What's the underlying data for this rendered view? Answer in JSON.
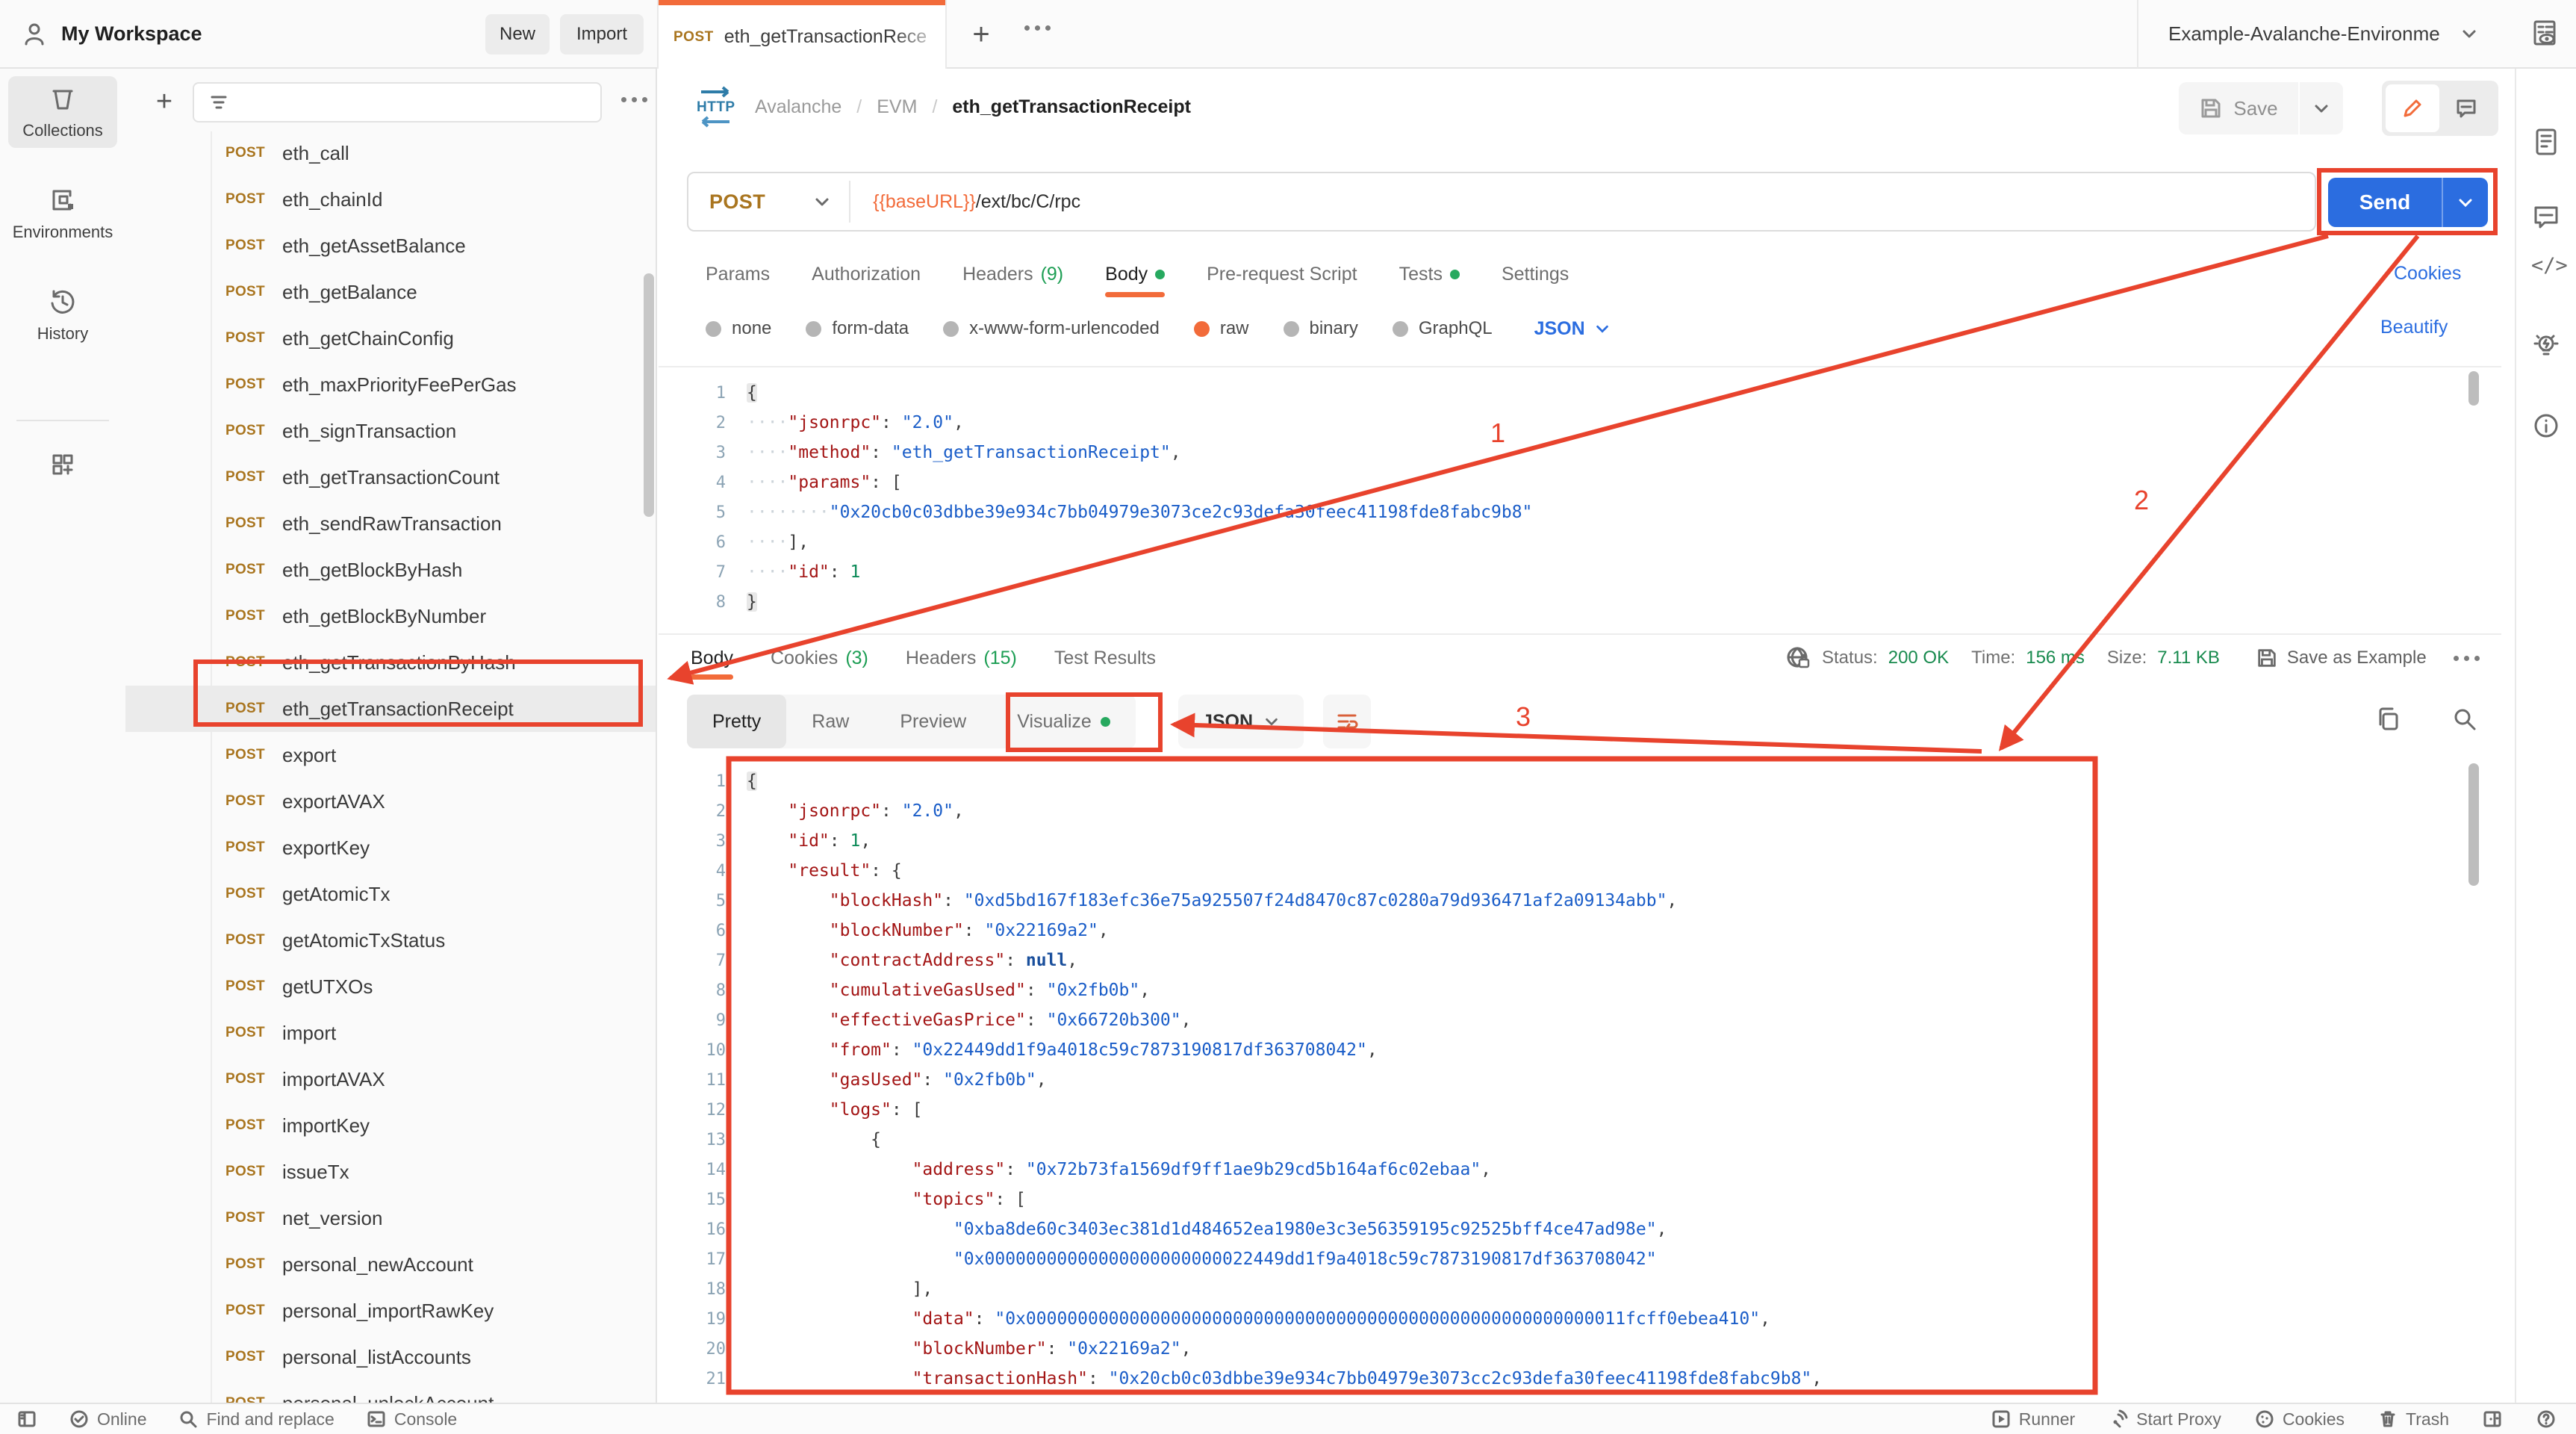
{
  "header": {
    "workspace": "My Workspace",
    "new_button": "New",
    "import_button": "Import",
    "environment": "Example-Avalanche-Environme",
    "tab": {
      "method": "POST",
      "title": "eth_getTransactionRece"
    }
  },
  "left_rail": {
    "items": [
      {
        "label": "Collections",
        "active": true
      },
      {
        "label": "Environments",
        "active": false
      },
      {
        "label": "History",
        "active": false
      }
    ]
  },
  "collection": {
    "selected_index": 12,
    "requests": [
      {
        "method": "POST",
        "name": "eth_call"
      },
      {
        "method": "POST",
        "name": "eth_chainId"
      },
      {
        "method": "POST",
        "name": "eth_getAssetBalance"
      },
      {
        "method": "POST",
        "name": "eth_getBalance"
      },
      {
        "method": "POST",
        "name": "eth_getChainConfig"
      },
      {
        "method": "POST",
        "name": "eth_maxPriorityFeePerGas"
      },
      {
        "method": "POST",
        "name": "eth_signTransaction"
      },
      {
        "method": "POST",
        "name": "eth_getTransactionCount"
      },
      {
        "method": "POST",
        "name": "eth_sendRawTransaction"
      },
      {
        "method": "POST",
        "name": "eth_getBlockByHash"
      },
      {
        "method": "POST",
        "name": "eth_getBlockByNumber"
      },
      {
        "method": "POST",
        "name": "eth_getTransactionByHash"
      },
      {
        "method": "POST",
        "name": "eth_getTransactionReceipt"
      },
      {
        "method": "POST",
        "name": "export"
      },
      {
        "method": "POST",
        "name": "exportAVAX"
      },
      {
        "method": "POST",
        "name": "exportKey"
      },
      {
        "method": "POST",
        "name": "getAtomicTx"
      },
      {
        "method": "POST",
        "name": "getAtomicTxStatus"
      },
      {
        "method": "POST",
        "name": "getUTXOs"
      },
      {
        "method": "POST",
        "name": "import"
      },
      {
        "method": "POST",
        "name": "importAVAX"
      },
      {
        "method": "POST",
        "name": "importKey"
      },
      {
        "method": "POST",
        "name": "issueTx"
      },
      {
        "method": "POST",
        "name": "net_version"
      },
      {
        "method": "POST",
        "name": "personal_newAccount"
      },
      {
        "method": "POST",
        "name": "personal_importRawKey"
      },
      {
        "method": "POST",
        "name": "personal_listAccounts"
      },
      {
        "method": "POST",
        "name": "personal_unlockAccount"
      }
    ]
  },
  "request": {
    "breadcrumb": [
      "Avalanche",
      "EVM"
    ],
    "title": "eth_getTransactionReceipt",
    "save": "Save",
    "method": "POST",
    "url_var": "{{baseURL}}",
    "url_path": "/ext/bc/C/rpc",
    "send": "Send",
    "cookies_link": "Cookies",
    "beautify_link": "Beautify",
    "language": "JSON",
    "tabs": [
      {
        "label": "Params"
      },
      {
        "label": "Authorization"
      },
      {
        "label": "Headers",
        "count": "(9)"
      },
      {
        "label": "Body",
        "active": true,
        "dot": true
      },
      {
        "label": "Pre-request Script"
      },
      {
        "label": "Tests",
        "dot": true
      },
      {
        "label": "Settings"
      }
    ],
    "body_types": [
      {
        "label": "none"
      },
      {
        "label": "form-data"
      },
      {
        "label": "x-www-form-urlencoded"
      },
      {
        "label": "raw",
        "selected": true
      },
      {
        "label": "binary"
      },
      {
        "label": "GraphQL"
      }
    ],
    "code": [
      [
        [
          "ph",
          "{"
        ]
      ],
      [
        [
          "ws",
          "····"
        ],
        [
          "k",
          "\"jsonrpc\""
        ],
        [
          "p",
          ": "
        ],
        [
          "s",
          "\"2.0\""
        ],
        [
          "p",
          ","
        ]
      ],
      [
        [
          "ws",
          "····"
        ],
        [
          "k",
          "\"method\""
        ],
        [
          "p",
          ": "
        ],
        [
          "s",
          "\"eth_getTransactionReceipt\""
        ],
        [
          "p",
          ","
        ]
      ],
      [
        [
          "ws",
          "····"
        ],
        [
          "k",
          "\"params\""
        ],
        [
          "p",
          ": "
        ],
        [
          "p",
          "["
        ]
      ],
      [
        [
          "ws",
          "········"
        ],
        [
          "s",
          "\"0x20cb0c03dbbe39e934c7bb04979e3073ce2c93defa30feec41198fde8fabc9b8\""
        ]
      ],
      [
        [
          "ws",
          "····"
        ],
        [
          "p",
          "],"
        ]
      ],
      [
        [
          "ws",
          "····"
        ],
        [
          "k",
          "\"id\""
        ],
        [
          "p",
          ": "
        ],
        [
          "n",
          "1"
        ]
      ],
      [
        [
          "ph",
          "}"
        ]
      ]
    ]
  },
  "response": {
    "status_label": "Status:",
    "status": "200 OK",
    "time_label": "Time:",
    "time": "156 ms",
    "size_label": "Size:",
    "size": "7.11 KB",
    "save_as_example": "Save as Example",
    "language": "JSON",
    "tabs": [
      {
        "label": "Body",
        "active": true
      },
      {
        "label": "Cookies",
        "count": "(3)"
      },
      {
        "label": "Headers",
        "count": "(15)"
      },
      {
        "label": "Test Results"
      }
    ],
    "view_tabs": [
      {
        "label": "Pretty",
        "active": true
      },
      {
        "label": "Raw"
      },
      {
        "label": "Preview"
      },
      {
        "label": "Visualize",
        "dot": true
      }
    ],
    "code": [
      [
        [
          "ph",
          "{"
        ]
      ],
      [
        [
          "sp",
          "    "
        ],
        [
          "k",
          "\"jsonrpc\""
        ],
        [
          "p",
          ": "
        ],
        [
          "s",
          "\"2.0\""
        ],
        [
          "p",
          ","
        ]
      ],
      [
        [
          "sp",
          "    "
        ],
        [
          "k",
          "\"id\""
        ],
        [
          "p",
          ": "
        ],
        [
          "n",
          "1"
        ],
        [
          "p",
          ","
        ]
      ],
      [
        [
          "sp",
          "    "
        ],
        [
          "k",
          "\"result\""
        ],
        [
          "p",
          ": "
        ],
        [
          "p",
          "{"
        ]
      ],
      [
        [
          "sp",
          "        "
        ],
        [
          "k",
          "\"blockHash\""
        ],
        [
          "p",
          ": "
        ],
        [
          "s",
          "\"0xd5bd167f183efc36e75a925507f24d8470c87c0280a79d936471af2a09134abb\""
        ],
        [
          "p",
          ","
        ]
      ],
      [
        [
          "sp",
          "        "
        ],
        [
          "k",
          "\"blockNumber\""
        ],
        [
          "p",
          ": "
        ],
        [
          "s",
          "\"0x22169a2\""
        ],
        [
          "p",
          ","
        ]
      ],
      [
        [
          "sp",
          "        "
        ],
        [
          "k",
          "\"contractAddress\""
        ],
        [
          "p",
          ": "
        ],
        [
          "kw",
          "null"
        ],
        [
          "p",
          ","
        ]
      ],
      [
        [
          "sp",
          "        "
        ],
        [
          "k",
          "\"cumulativeGasUsed\""
        ],
        [
          "p",
          ": "
        ],
        [
          "s",
          "\"0x2fb0b\""
        ],
        [
          "p",
          ","
        ]
      ],
      [
        [
          "sp",
          "        "
        ],
        [
          "k",
          "\"effectiveGasPrice\""
        ],
        [
          "p",
          ": "
        ],
        [
          "s",
          "\"0x66720b300\""
        ],
        [
          "p",
          ","
        ]
      ],
      [
        [
          "sp",
          "        "
        ],
        [
          "k",
          "\"from\""
        ],
        [
          "p",
          ": "
        ],
        [
          "s",
          "\"0x22449dd1f9a4018c59c7873190817df363708042\""
        ],
        [
          "p",
          ","
        ]
      ],
      [
        [
          "sp",
          "        "
        ],
        [
          "k",
          "\"gasUsed\""
        ],
        [
          "p",
          ": "
        ],
        [
          "s",
          "\"0x2fb0b\""
        ],
        [
          "p",
          ","
        ]
      ],
      [
        [
          "sp",
          "        "
        ],
        [
          "k",
          "\"logs\""
        ],
        [
          "p",
          ": "
        ],
        [
          "p",
          "["
        ]
      ],
      [
        [
          "sp",
          "            "
        ],
        [
          "p",
          "{"
        ]
      ],
      [
        [
          "sp",
          "                "
        ],
        [
          "k",
          "\"address\""
        ],
        [
          "p",
          ": "
        ],
        [
          "s",
          "\"0x72b73fa1569df9ff1ae9b29cd5b164af6c02ebaa\""
        ],
        [
          "p",
          ","
        ]
      ],
      [
        [
          "sp",
          "                "
        ],
        [
          "k",
          "\"topics\""
        ],
        [
          "p",
          ": "
        ],
        [
          "p",
          "["
        ]
      ],
      [
        [
          "sp",
          "                    "
        ],
        [
          "s",
          "\"0xba8de60c3403ec381d1d484652ea1980e3c3e56359195c92525bff4ce47ad98e\""
        ],
        [
          "p",
          ","
        ]
      ],
      [
        [
          "sp",
          "                    "
        ],
        [
          "s",
          "\"0x00000000000000000000000022449dd1f9a4018c59c7873190817df363708042\""
        ]
      ],
      [
        [
          "sp",
          "                "
        ],
        [
          "p",
          "],"
        ]
      ],
      [
        [
          "sp",
          "                "
        ],
        [
          "k",
          "\"data\""
        ],
        [
          "p",
          ": "
        ],
        [
          "s",
          "\"0x0000000000000000000000000000000000000000000000000000000011fcff0ebea410\""
        ],
        [
          "p",
          ","
        ]
      ],
      [
        [
          "sp",
          "                "
        ],
        [
          "k",
          "\"blockNumber\""
        ],
        [
          "p",
          ": "
        ],
        [
          "s",
          "\"0x22169a2\""
        ],
        [
          "p",
          ","
        ]
      ],
      [
        [
          "sp",
          "                "
        ],
        [
          "k",
          "\"transactionHash\""
        ],
        [
          "p",
          ": "
        ],
        [
          "s",
          "\"0x20cb0c03dbbe39e934c7bb04979e3073cc2c93defa30feec41198fde8fabc9b8\""
        ],
        [
          "p",
          ","
        ]
      ]
    ]
  },
  "footer": {
    "online": "Online",
    "find": "Find and replace",
    "console": "Console",
    "runner": "Runner",
    "start_proxy": "Start Proxy",
    "cookies": "Cookies",
    "trash": "Trash"
  },
  "annotations": {
    "one": "1",
    "two": "2",
    "three": "3"
  },
  "colors": {
    "accent_orange": "#f26b3a",
    "send_blue": "#2b6de0",
    "annotation_red": "#e8432d",
    "green": "#1d9e54",
    "method_gold": "#a9751f"
  }
}
